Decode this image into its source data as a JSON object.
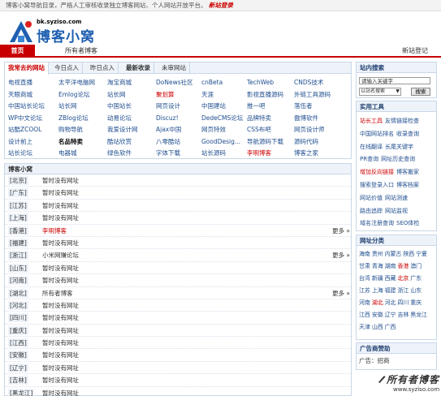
{
  "topbar": {
    "notice": "博客小窝导航目录，严格人工审核收录独立博客网站、个人网站开放平台。",
    "link": "新站登录"
  },
  "logo": {
    "url": "bk.syziso.com",
    "name": "博客小窝"
  },
  "nav": {
    "home": "首页",
    "all_blogs": "所有者博客",
    "new_site": "新站登记"
  },
  "hot_sites": {
    "tabs": [
      "我常去的网站",
      "今日点入",
      "昨日点入",
      "最新收录",
      "未审网站"
    ],
    "rows": [
      [
        {
          "t": "电视直播"
        },
        {
          "t": "太平洋电脑网"
        },
        {
          "t": "淘宝商城"
        },
        {
          "t": "DoNews社区"
        },
        {
          "t": "cnBeta"
        },
        {
          "t": "TechWeb"
        },
        {
          "t": "CNDS技术"
        }
      ],
      [
        {
          "t": "天眼商城"
        },
        {
          "t": "Emlog论坛"
        },
        {
          "t": "站长网"
        },
        {
          "t": "聚划算",
          "red": true
        },
        {
          "t": "天涯"
        },
        {
          "t": "影视直播源码"
        },
        {
          "t": "外链工具源码"
        }
      ],
      [
        {
          "t": "中国站长论坛"
        },
        {
          "t": "站长网"
        },
        {
          "t": "中国站长"
        },
        {
          "t": "网页设计"
        },
        {
          "t": "中国建站"
        },
        {
          "t": "推一吧"
        },
        {
          "t": "落伍者"
        }
      ],
      [
        {
          "t": "WP中文论坛"
        },
        {
          "t": "ZBlog论坛"
        },
        {
          "t": "动易论坛"
        },
        {
          "t": "Discuz!"
        },
        {
          "t": "DedeCMS论坛"
        },
        {
          "t": "品牌特卖"
        },
        {
          "t": "傲博软件"
        }
      ],
      [
        {
          "t": "站酷ZCOOL"
        },
        {
          "t": "购物导航"
        },
        {
          "t": "我爱设计网"
        },
        {
          "t": "Ajax中国"
        },
        {
          "t": "网页特效"
        },
        {
          "t": "CSS布吧"
        },
        {
          "t": "网页设计师"
        }
      ],
      [
        {
          "t": "设计前上"
        },
        {
          "t": "名品特卖",
          "bold": true
        },
        {
          "t": "酷站欣赏"
        },
        {
          "t": "八零酷站"
        },
        {
          "t": "GoodDesig..."
        },
        {
          "t": "导航源码下载"
        },
        {
          "t": "源码代码"
        }
      ],
      [
        {
          "t": "站长论坛"
        },
        {
          "t": "电器城"
        },
        {
          "t": "绿色软件"
        },
        {
          "t": "字体下载"
        },
        {
          "t": "站长源码"
        },
        {
          "t": "李明博客",
          "red": true
        },
        {
          "t": "博客之家"
        }
      ]
    ]
  },
  "blog_section": {
    "title": "博客小窝",
    "more": "更多 »",
    "regions": [
      {
        "name": "[北京]",
        "value": "暂时没有网址"
      },
      {
        "name": "[广东]",
        "value": "暂时没有网址"
      },
      {
        "name": "[江苏]",
        "value": "暂时没有网址"
      },
      {
        "name": "[上海]",
        "value": "暂时没有网址"
      },
      {
        "name": "[香港]",
        "value": "李明博客",
        "red": true,
        "more": true
      },
      {
        "name": "[福建]",
        "value": "暂时没有网址"
      },
      {
        "name": "[浙江]",
        "value": "小米网赚论坛",
        "more": true
      },
      {
        "name": "[山东]",
        "value": "暂时没有网址"
      },
      {
        "name": "[河南]",
        "value": "暂时没有网址"
      },
      {
        "name": "[湖北]",
        "value": "所有者博客",
        "more": true
      },
      {
        "name": "[河北]",
        "value": "暂时没有网址"
      },
      {
        "name": "[四川]",
        "value": "暂时没有网址"
      },
      {
        "name": "[重庆]",
        "value": "暂时没有网址"
      },
      {
        "name": "[江西]",
        "value": "暂时没有网址"
      },
      {
        "name": "[安徽]",
        "value": "暂时没有网址"
      },
      {
        "name": "[辽宁]",
        "value": "暂时没有网址"
      },
      {
        "name": "[吉林]",
        "value": "暂时没有网址"
      },
      {
        "name": "[黑龙江]",
        "value": "暂时没有网址"
      }
    ]
  },
  "sidebar": {
    "search": {
      "title": "站内搜索",
      "placeholder": "请输入关键字",
      "select": "以站名搜索",
      "button": "搜索"
    },
    "tools": {
      "title": "实用工具",
      "rows": [
        [
          {
            "t": "站长工具",
            "red": true
          },
          {
            "t": "友情链接检查"
          }
        ],
        [
          {
            "t": "中国网站排名"
          },
          {
            "t": "收录查询"
          }
        ],
        [
          {
            "t": "在线翻译"
          },
          {
            "t": "长尾关键字"
          }
        ],
        [
          {
            "t": "PR查询"
          },
          {
            "t": "网址历史查询"
          }
        ],
        [
          {
            "t": "增加反向链接",
            "red": true
          },
          {
            "t": "博客搬家"
          }
        ],
        [
          {
            "t": "搜索登录入口"
          },
          {
            "t": "博客档案"
          }
        ],
        [
          {
            "t": "网站价值"
          },
          {
            "t": "网站测速"
          }
        ],
        [
          {
            "t": "路由追踪"
          },
          {
            "t": "网站监视"
          }
        ],
        [
          {
            "t": "域名注册查询"
          },
          {
            "t": "SEO体检"
          }
        ]
      ]
    },
    "categories": {
      "title": "网址分类",
      "rows": [
        [
          {
            "t": "海南"
          },
          {
            "t": "贵州"
          },
          {
            "t": "内蒙古"
          },
          {
            "t": "陕西"
          },
          {
            "t": "宁夏"
          }
        ],
        [
          {
            "t": "甘肃"
          },
          {
            "t": "青海"
          },
          {
            "t": "湖南"
          },
          {
            "t": "香港",
            "red": true
          },
          {
            "t": "澳门"
          }
        ],
        [
          {
            "t": "台湾"
          },
          {
            "t": "新疆"
          },
          {
            "t": "西藏"
          },
          {
            "t": "北京",
            "red": true
          },
          {
            "t": "广东"
          }
        ],
        [
          {
            "t": "江苏"
          },
          {
            "t": "上海"
          },
          {
            "t": "福建"
          },
          {
            "t": "浙江"
          },
          {
            "t": "山东"
          }
        ],
        [
          {
            "t": "河南"
          },
          {
            "t": "湖北",
            "red": true
          },
          {
            "t": "河北"
          },
          {
            "t": "四川"
          },
          {
            "t": "重庆"
          }
        ],
        [
          {
            "t": "江西"
          },
          {
            "t": "安徽"
          },
          {
            "t": "辽宁"
          },
          {
            "t": "吉林"
          },
          {
            "t": "黑龙江"
          }
        ],
        [
          {
            "t": "天津"
          },
          {
            "t": "山西"
          },
          {
            "t": "广西"
          }
        ]
      ]
    },
    "ads": {
      "title": "广告商赞助",
      "text": "广告：招商"
    }
  },
  "watermark": {
    "text": "所有者博客",
    "url": "www.syziso.com"
  }
}
